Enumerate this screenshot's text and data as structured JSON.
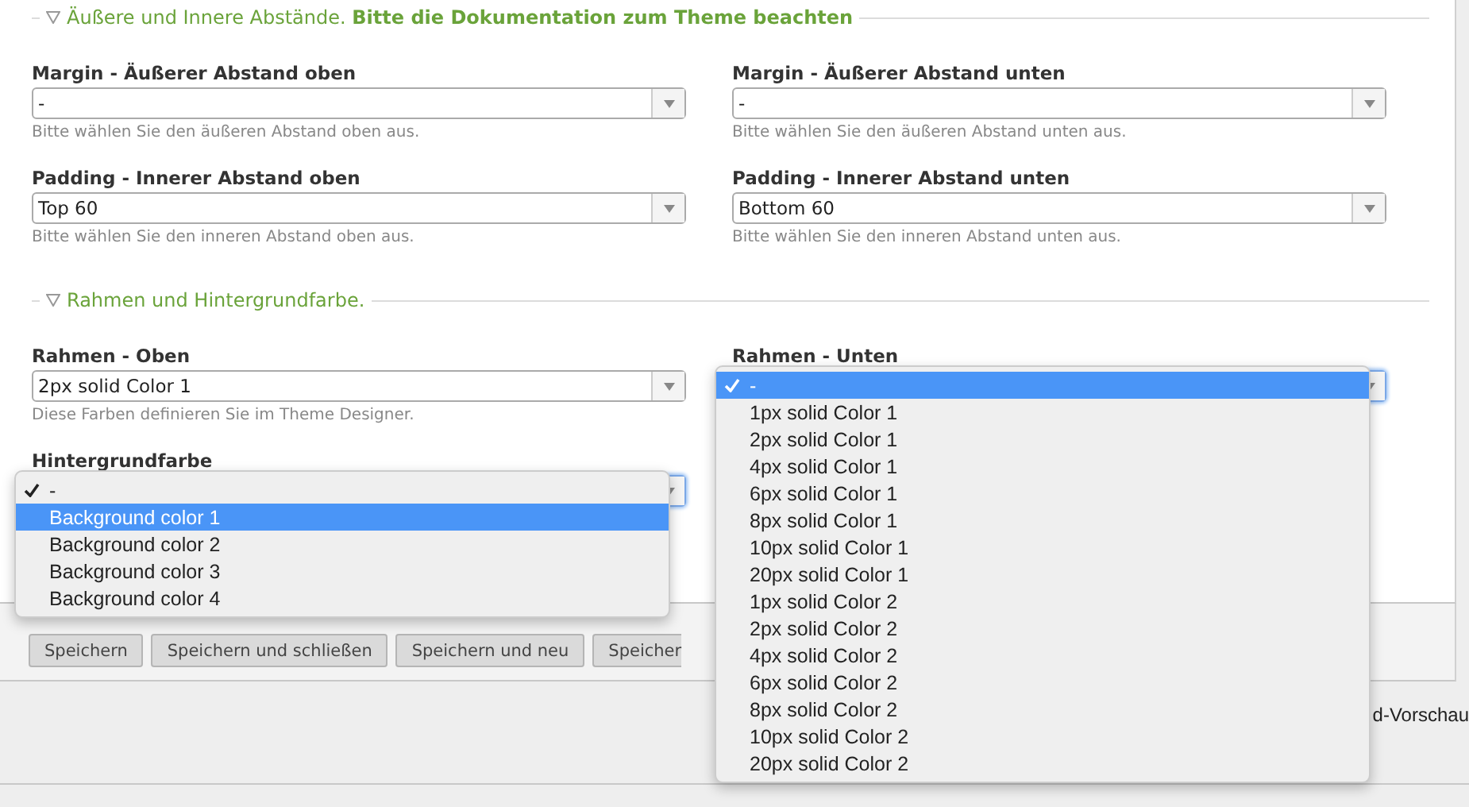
{
  "sections": [
    {
      "title": "Äußere und Innere Abstände.",
      "title_bold": "Bitte die Dokumentation zum Theme beachten",
      "expanded": true,
      "fields": [
        {
          "label": "Margin - Äußerer Abstand oben",
          "value": "-",
          "hint": "Bitte wählen Sie den äußeren Abstand oben aus.",
          "open": false
        },
        {
          "label": "Margin - Äußerer Abstand unten",
          "value": "-",
          "hint": "Bitte wählen Sie den äußeren Abstand unten aus.",
          "open": false
        },
        {
          "label": "Padding - Innerer Abstand oben",
          "value": "Top 60",
          "hint": "Bitte wählen Sie den inneren Abstand oben aus.",
          "open": false
        },
        {
          "label": "Padding - Innerer Abstand unten",
          "value": "Bottom 60",
          "hint": "Bitte wählen Sie den inneren Abstand unten aus.",
          "open": false
        }
      ]
    },
    {
      "title": "Rahmen und Hintergrundfarbe.",
      "expanded": true,
      "fields": [
        {
          "label": "Rahmen - Oben",
          "value": "2px solid Color 1",
          "hint": "Diese Farben definieren Sie im Theme Designer.",
          "open": false
        },
        {
          "label": "Rahmen - Unten",
          "open": true,
          "options": [
            {
              "label": "-",
              "checked": true,
              "selected": true
            },
            {
              "label": "1px solid Color 1",
              "checked": false,
              "selected": false
            },
            {
              "label": "2px solid Color 1",
              "checked": false,
              "selected": false
            },
            {
              "label": "4px solid Color 1",
              "checked": false,
              "selected": false
            },
            {
              "label": "6px solid Color 1",
              "checked": false,
              "selected": false
            },
            {
              "label": "8px solid Color 1",
              "checked": false,
              "selected": false
            },
            {
              "label": "10px solid Color 1",
              "checked": false,
              "selected": false
            },
            {
              "label": "20px solid Color 1",
              "checked": false,
              "selected": false
            },
            {
              "label": "1px solid Color 2",
              "checked": false,
              "selected": false
            },
            {
              "label": "2px solid Color 2",
              "checked": false,
              "selected": false
            },
            {
              "label": "4px solid Color 2",
              "checked": false,
              "selected": false
            },
            {
              "label": "6px solid Color 2",
              "checked": false,
              "selected": false
            },
            {
              "label": "8px solid Color 2",
              "checked": false,
              "selected": false
            },
            {
              "label": "10px solid Color 2",
              "checked": false,
              "selected": false
            },
            {
              "label": "20px solid Color 2",
              "checked": false,
              "selected": false
            }
          ]
        },
        {
          "label": "Hintergrundfarbe",
          "open": true,
          "options": [
            {
              "label": "-",
              "checked": true,
              "selected": false
            },
            {
              "label": "Background color 1",
              "checked": false,
              "selected": true
            },
            {
              "label": "Background color 2",
              "checked": false,
              "selected": false
            },
            {
              "label": "Background color 3",
              "checked": false,
              "selected": false
            },
            {
              "label": "Background color 4",
              "checked": false,
              "selected": false
            }
          ]
        }
      ]
    }
  ],
  "buttons": [
    "Speichern",
    "Speichern und schließen",
    "Speichern und neu",
    "Speicher"
  ],
  "footer_text": "d-Vorschau"
}
